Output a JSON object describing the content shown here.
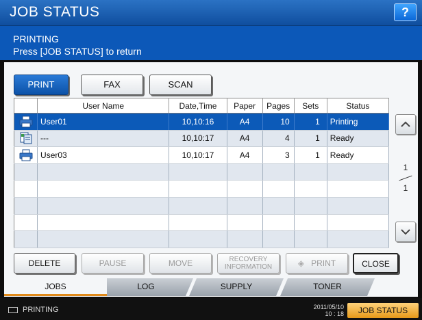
{
  "window": {
    "title": "JOB STATUS",
    "help_label": "?"
  },
  "message": {
    "status": "PRINTING",
    "hint": "Press [JOB STATUS] to return"
  },
  "job_tabs": {
    "print": "PRINT",
    "fax": "FAX",
    "scan": "SCAN",
    "selected": "PRINT"
  },
  "table": {
    "headers": {
      "user": "User Name",
      "date": "Date,Time",
      "paper": "Paper",
      "pages": "Pages",
      "sets": "Sets",
      "status": "Status"
    },
    "rows": [
      {
        "icon": "printer-icon",
        "user": "User01",
        "date": "10,10:16",
        "paper": "A4",
        "pages": "10",
        "sets": "1",
        "status": "Printing",
        "selected": true
      },
      {
        "icon": "document-icon",
        "user": "---",
        "date": "10,10:17",
        "paper": "A4",
        "pages": "4",
        "sets": "1",
        "status": "Ready"
      },
      {
        "icon": "printer-icon",
        "user": "User03",
        "date": "10,10:17",
        "paper": "A4",
        "pages": "3",
        "sets": "1",
        "status": "Ready"
      },
      {
        "icon": "",
        "user": "",
        "date": "",
        "paper": "",
        "pages": "",
        "sets": "",
        "status": ""
      },
      {
        "icon": "",
        "user": "",
        "date": "",
        "paper": "",
        "pages": "",
        "sets": "",
        "status": ""
      },
      {
        "icon": "",
        "user": "",
        "date": "",
        "paper": "",
        "pages": "",
        "sets": "",
        "status": ""
      },
      {
        "icon": "",
        "user": "",
        "date": "",
        "paper": "",
        "pages": "",
        "sets": "",
        "status": ""
      },
      {
        "icon": "",
        "user": "",
        "date": "",
        "paper": "",
        "pages": "",
        "sets": "",
        "status": ""
      }
    ]
  },
  "pagination": {
    "current": "1",
    "total": "1"
  },
  "actions": {
    "delete": "DELETE",
    "pause": "PAUSE",
    "move": "MOVE",
    "recovery_line1": "RECOVERY",
    "recovery_line2": "INFORMATION",
    "print": "PRINT",
    "close": "CLOSE"
  },
  "bottom_tabs": {
    "jobs": "JOBS",
    "log": "LOG",
    "supply": "SUPPLY",
    "toner": "TONER"
  },
  "status_bar": {
    "state": "PRINTING",
    "date": "2011/05/10",
    "time": "10 : 18",
    "job_status": "JOB STATUS"
  },
  "colors": {
    "accent": "#0c5ab8",
    "title_bar": "#1a60b5",
    "highlight_tab": "#e08a1a",
    "job_status_btn": "#f0b040"
  }
}
